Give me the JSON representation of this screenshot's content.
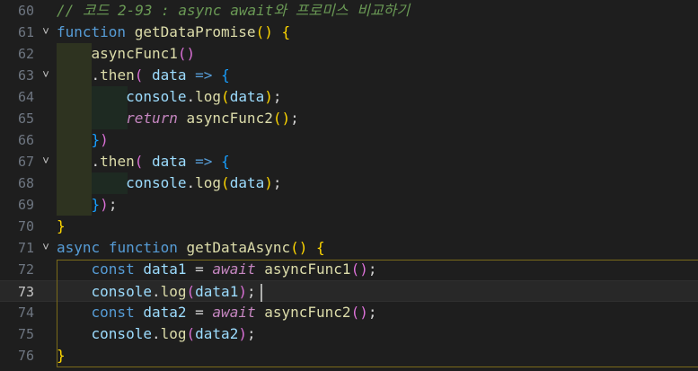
{
  "editor": {
    "current_line": "73",
    "lines": [
      {
        "num": "60",
        "tokens": [
          [
            "cm",
            "// 코드 2-93 : async await와 프로미스 비교하기"
          ]
        ]
      },
      {
        "num": "61",
        "tokens": [
          [
            "kw",
            "function"
          ],
          [
            "plain",
            " "
          ],
          [
            "fn",
            "getDataPromise"
          ],
          [
            "p1",
            "()"
          ],
          [
            "plain",
            " "
          ],
          [
            "p1",
            "{"
          ]
        ]
      },
      {
        "num": "62",
        "tokens": [
          [
            "plain",
            "    "
          ],
          [
            "fn",
            "asyncFunc1"
          ],
          [
            "p2",
            "()"
          ]
        ]
      },
      {
        "num": "63",
        "tokens": [
          [
            "plain",
            "    ."
          ],
          [
            "fn",
            "then"
          ],
          [
            "p2",
            "("
          ],
          [
            "plain",
            " "
          ],
          [
            "var",
            "data"
          ],
          [
            "plain",
            " "
          ],
          [
            "kw",
            "=>"
          ],
          [
            "plain",
            " "
          ],
          [
            "p3",
            "{"
          ]
        ]
      },
      {
        "num": "64",
        "tokens": [
          [
            "plain",
            "        "
          ],
          [
            "var",
            "console"
          ],
          [
            "plain",
            "."
          ],
          [
            "fn",
            "log"
          ],
          [
            "p1",
            "("
          ],
          [
            "var",
            "data"
          ],
          [
            "p1",
            ")"
          ],
          [
            "plain",
            ";"
          ]
        ]
      },
      {
        "num": "65",
        "tokens": [
          [
            "plain",
            "        "
          ],
          [
            "ctrl",
            "return"
          ],
          [
            "plain",
            " "
          ],
          [
            "fn",
            "asyncFunc2"
          ],
          [
            "p1",
            "()"
          ],
          [
            "plain",
            ";"
          ]
        ]
      },
      {
        "num": "66",
        "tokens": [
          [
            "plain",
            "    "
          ],
          [
            "p3",
            "}"
          ],
          [
            "p2",
            ")"
          ]
        ]
      },
      {
        "num": "67",
        "tokens": [
          [
            "plain",
            "    ."
          ],
          [
            "fn",
            "then"
          ],
          [
            "p2",
            "("
          ],
          [
            "plain",
            " "
          ],
          [
            "var",
            "data"
          ],
          [
            "plain",
            " "
          ],
          [
            "kw",
            "=>"
          ],
          [
            "plain",
            " "
          ],
          [
            "p3",
            "{"
          ]
        ]
      },
      {
        "num": "68",
        "tokens": [
          [
            "plain",
            "        "
          ],
          [
            "var",
            "console"
          ],
          [
            "plain",
            "."
          ],
          [
            "fn",
            "log"
          ],
          [
            "p1",
            "("
          ],
          [
            "var",
            "data"
          ],
          [
            "p1",
            ")"
          ],
          [
            "plain",
            ";"
          ]
        ]
      },
      {
        "num": "69",
        "tokens": [
          [
            "plain",
            "    "
          ],
          [
            "p3",
            "}"
          ],
          [
            "p2",
            ")"
          ],
          [
            "plain",
            ";"
          ]
        ]
      },
      {
        "num": "70",
        "tokens": [
          [
            "p1",
            "}"
          ]
        ]
      },
      {
        "num": "71",
        "tokens": [
          [
            "kw",
            "async"
          ],
          [
            "plain",
            " "
          ],
          [
            "kw",
            "function"
          ],
          [
            "plain",
            " "
          ],
          [
            "fn",
            "getDataAsync"
          ],
          [
            "p1",
            "()"
          ],
          [
            "plain",
            " "
          ],
          [
            "p1",
            "{"
          ]
        ]
      },
      {
        "num": "72",
        "tokens": [
          [
            "plain",
            "    "
          ],
          [
            "kw",
            "const"
          ],
          [
            "plain",
            " "
          ],
          [
            "var",
            "data1"
          ],
          [
            "plain",
            " = "
          ],
          [
            "ctrl",
            "await"
          ],
          [
            "plain",
            " "
          ],
          [
            "fn",
            "asyncFunc1"
          ],
          [
            "p2",
            "()"
          ],
          [
            "plain",
            ";"
          ]
        ]
      },
      {
        "num": "73",
        "tokens": [
          [
            "plain",
            "    "
          ],
          [
            "var",
            "console"
          ],
          [
            "plain",
            "."
          ],
          [
            "fn",
            "log"
          ],
          [
            "p2",
            "("
          ],
          [
            "var",
            "data1"
          ],
          [
            "p2",
            ")"
          ],
          [
            "plain",
            ";"
          ]
        ]
      },
      {
        "num": "74",
        "tokens": [
          [
            "plain",
            "    "
          ],
          [
            "kw",
            "const"
          ],
          [
            "plain",
            " "
          ],
          [
            "var",
            "data2"
          ],
          [
            "plain",
            " = "
          ],
          [
            "ctrl",
            "await"
          ],
          [
            "plain",
            " "
          ],
          [
            "fn",
            "asyncFunc2"
          ],
          [
            "p2",
            "()"
          ],
          [
            "plain",
            ";"
          ]
        ]
      },
      {
        "num": "75",
        "tokens": [
          [
            "plain",
            "    "
          ],
          [
            "var",
            "console"
          ],
          [
            "plain",
            "."
          ],
          [
            "fn",
            "log"
          ],
          [
            "p2",
            "("
          ],
          [
            "var",
            "data2"
          ],
          [
            "p2",
            ")"
          ],
          [
            "plain",
            ";"
          ]
        ]
      },
      {
        "num": "76",
        "tokens": [
          [
            "p1",
            "}"
          ]
        ]
      }
    ],
    "fold_markers": [
      "61",
      "63",
      "67",
      "71"
    ],
    "fold_glyph": "˅"
  },
  "colors": {
    "background": "#1e1e1e",
    "keyword": "#569cd6",
    "function": "#dcdcaa",
    "variable": "#9cdcfe",
    "control": "#c586c0",
    "comment": "#6a9955",
    "bracket_level1": "#ffd700",
    "bracket_level2": "#da70d6",
    "bracket_level3": "#179fff"
  }
}
